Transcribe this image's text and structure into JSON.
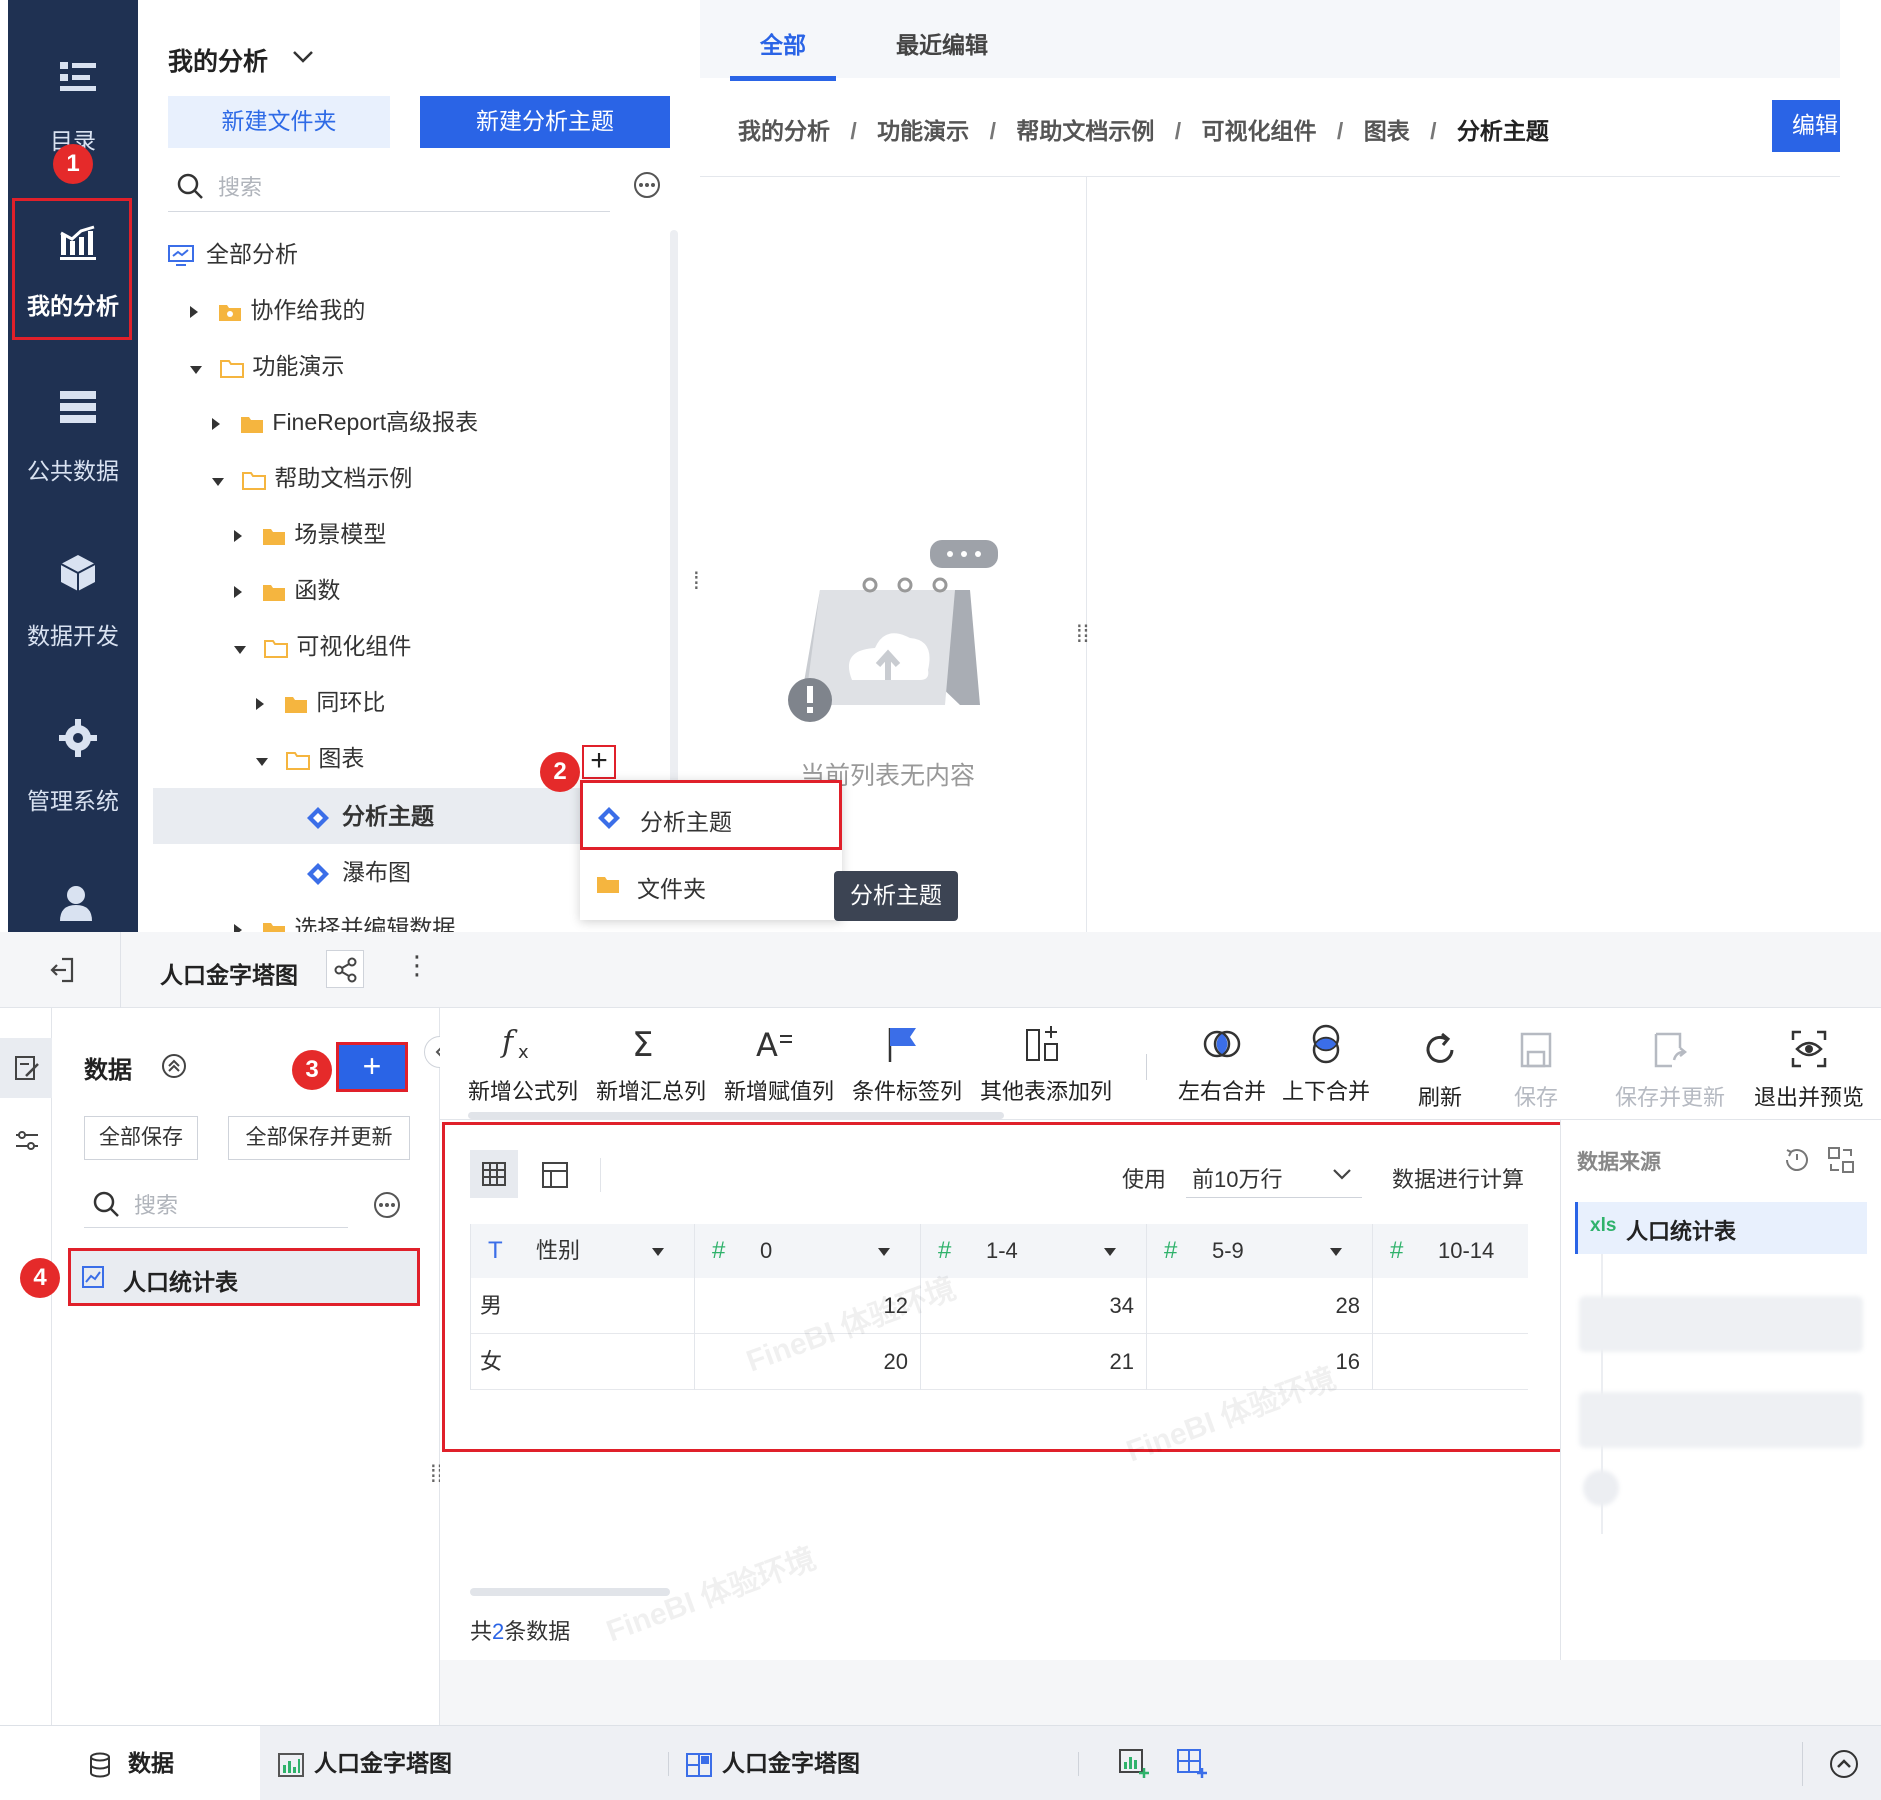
{
  "nav": {
    "items": [
      {
        "label": "目录",
        "icon": "list-icon"
      },
      {
        "label": "我的分析",
        "icon": "analysis-chart-icon"
      },
      {
        "label": "公共数据",
        "icon": "database-icon"
      },
      {
        "label": "数据开发",
        "icon": "cube-icon"
      },
      {
        "label": "管理系统",
        "icon": "gear-icon"
      },
      {
        "label": "",
        "icon": "user-icon"
      }
    ]
  },
  "badges": [
    "1",
    "2",
    "3",
    "4"
  ],
  "tree": {
    "title": "我的分析",
    "new_folder": "新建文件夹",
    "new_topic": "新建分析主题",
    "search_placeholder": "搜索",
    "items": [
      {
        "label": "全部分析"
      },
      {
        "label": "协作给我的"
      },
      {
        "label": "功能演示"
      },
      {
        "label": "FineReport高级报表"
      },
      {
        "label": "帮助文档示例"
      },
      {
        "label": "场景模型"
      },
      {
        "label": "函数"
      },
      {
        "label": "可视化组件"
      },
      {
        "label": "同环比"
      },
      {
        "label": "图表"
      },
      {
        "label": "分析主题"
      },
      {
        "label": "瀑布图"
      },
      {
        "label": "选择并编辑数据"
      }
    ]
  },
  "context_menu": {
    "plus": "+",
    "items": [
      {
        "label": "分析主题"
      },
      {
        "label": "文件夹"
      }
    ]
  },
  "right": {
    "tabs": [
      "全部",
      "最近编辑"
    ],
    "breadcrumb": [
      "我的分析",
      "功能演示",
      "帮助文档示例",
      "可视化组件",
      "图表",
      "分析主题"
    ],
    "separator": "/",
    "edit_button": "编辑",
    "empty_text": "当前列表无内容",
    "tooltip": "分析主题"
  },
  "editor": {
    "title": "人口金字塔图",
    "data_title": "数据",
    "save_all": "全部保存",
    "save_all_update": "全部保存并更新",
    "search_placeholder": "搜索",
    "add_symbol": "+",
    "dataset": "人口统计表",
    "tools": [
      {
        "label": "新增公式列",
        "icon": "formula-icon"
      },
      {
        "label": "新增汇总列",
        "icon": "sigma-icon"
      },
      {
        "label": "新增赋值列",
        "icon": "assign-icon"
      },
      {
        "label": "条件标签列",
        "icon": "flag-icon"
      },
      {
        "label": "其他表添加列",
        "icon": "add-column-icon"
      },
      {
        "label": "左右合并",
        "icon": "merge-lr-icon"
      },
      {
        "label": "上下合并",
        "icon": "merge-ud-icon"
      },
      {
        "label": "刷新",
        "icon": "refresh-icon"
      },
      {
        "label": "保存",
        "icon": "save-icon"
      },
      {
        "label": "保存并更新",
        "icon": "save-update-icon"
      },
      {
        "label": "退出并预览",
        "icon": "preview-icon"
      }
    ],
    "use_label": "使用",
    "rows_select": "前10万行",
    "compute_label": "数据进行计算",
    "columns": [
      {
        "type": "T",
        "name": "性别"
      },
      {
        "type": "#",
        "name": "0"
      },
      {
        "type": "#",
        "name": "1-4"
      },
      {
        "type": "#",
        "name": "5-9"
      },
      {
        "type": "#",
        "name": "10-14"
      }
    ],
    "rows": [
      [
        "男",
        "12",
        "34",
        "28",
        ""
      ],
      [
        "女",
        "20",
        "21",
        "16",
        ""
      ]
    ],
    "count_prefix": "共",
    "count_value": "2",
    "count_suffix": "条数据",
    "source_title": "数据来源",
    "source_item": "人口统计表",
    "source_badge": "xls",
    "watermark": "FineBI 体验环境"
  },
  "bottom_tabs": {
    "data": "数据",
    "chart1": "人口金字塔图",
    "chart2": "人口金字塔图"
  },
  "colors": {
    "nav_bg": "#1f3152",
    "accent": "#2a64e6",
    "highlight_red": "#e0202a",
    "folder": "#f5b53f"
  }
}
